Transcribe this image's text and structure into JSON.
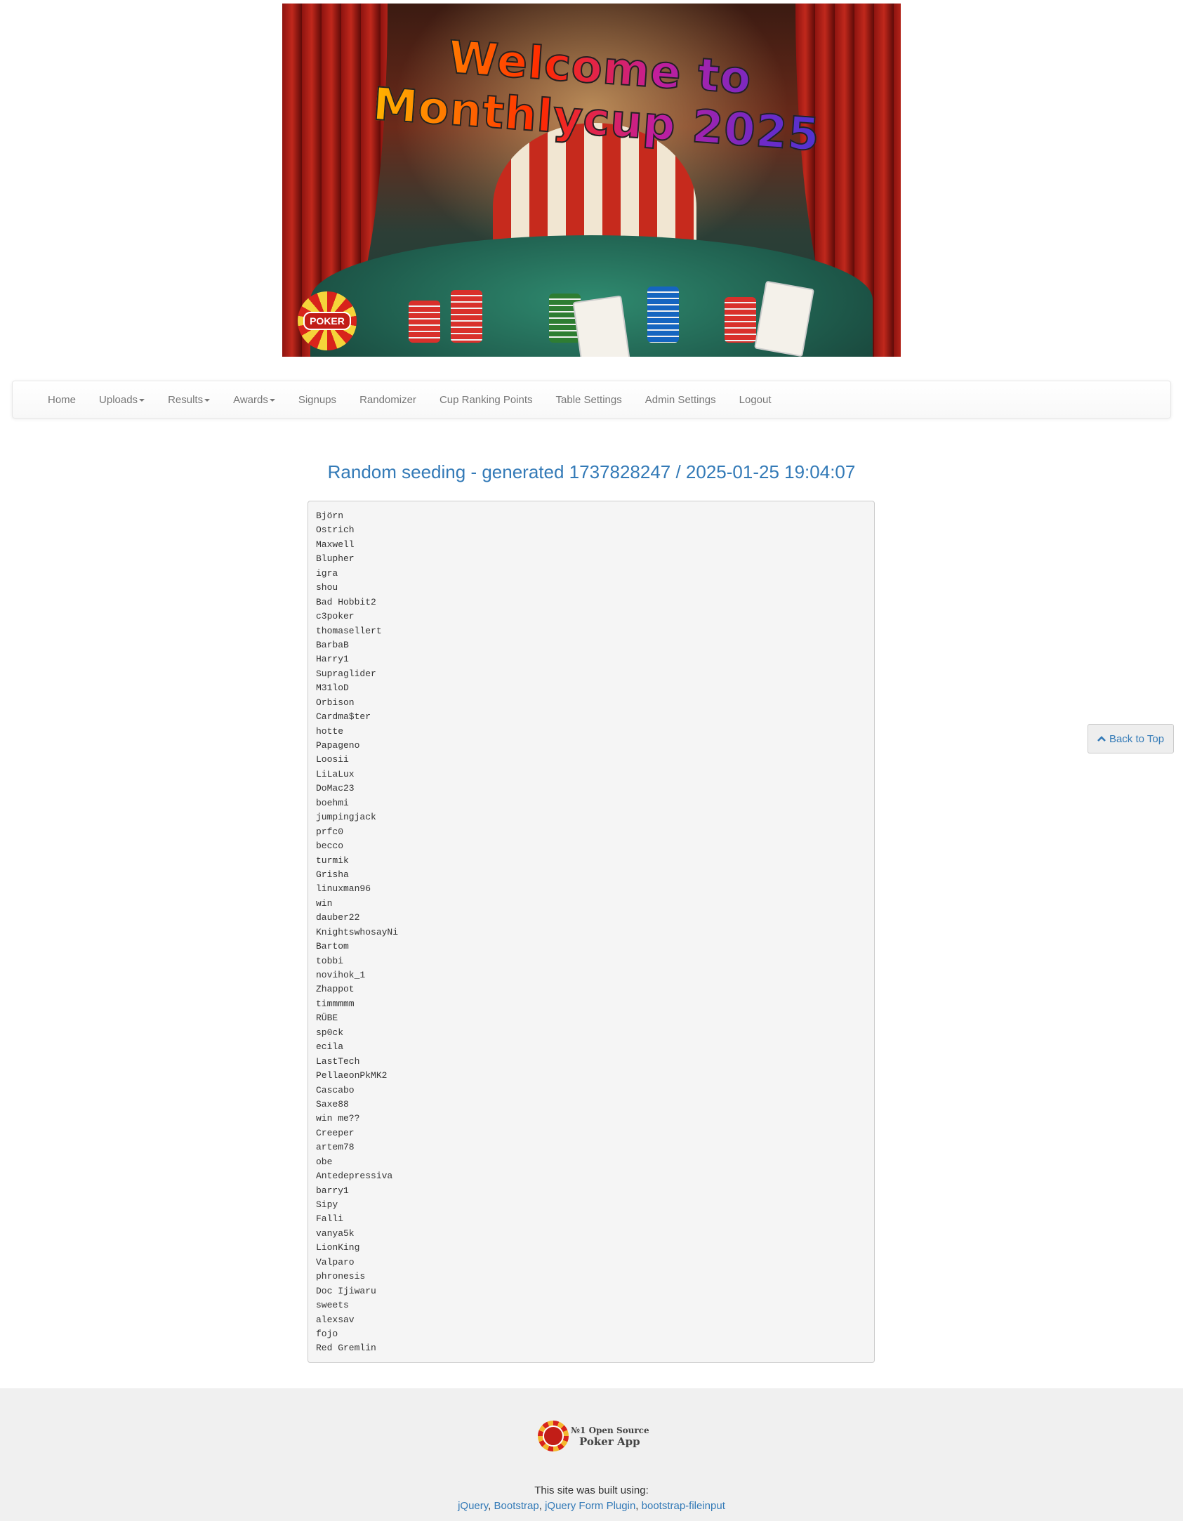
{
  "banner": {
    "title": "Welcome to Monthlycup 2025",
    "logo_text": "POKER"
  },
  "nav": {
    "items": [
      {
        "label": "Home",
        "dropdown": false
      },
      {
        "label": "Uploads",
        "dropdown": true
      },
      {
        "label": "Results",
        "dropdown": true
      },
      {
        "label": "Awards",
        "dropdown": true
      },
      {
        "label": "Signups",
        "dropdown": false
      },
      {
        "label": "Randomizer",
        "dropdown": false
      },
      {
        "label": "Cup Ranking Points",
        "dropdown": false
      },
      {
        "label": "Table Settings",
        "dropdown": false
      },
      {
        "label": "Admin Settings",
        "dropdown": false
      },
      {
        "label": "Logout",
        "dropdown": false
      }
    ]
  },
  "page": {
    "heading": "Random seeding - generated 1737828247 / 2025-01-25 19:04:07"
  },
  "seeding": [
    "Björn",
    "Ostrich",
    "Maxwell",
    "Blupher",
    "igra",
    "shou",
    "Bad Hobbit2",
    "c3poker",
    "thomasellert",
    "BarbaB",
    "Harry1",
    "Supraglider",
    "M31loD",
    "Orbison",
    "Cardma$ter",
    "hotte",
    "Papageno",
    "Loosii",
    "LiLaLux",
    "DoMac23",
    "boehmi",
    "jumpingjack",
    "prfc0",
    "becco",
    "turmik",
    "Grisha",
    "linuxman96",
    "win",
    "dauber22",
    "KnightswhosayNi",
    "Bartom",
    "tobbi",
    "novihok_1",
    "Zhappot",
    "timmmmm",
    "RÜBE",
    "sp0ck",
    "ecila",
    "LastTech",
    "PellaeonPkMK2",
    "Cascabo",
    "Saxe88",
    "win me??",
    "Creeper",
    "artem78",
    "obe",
    "Antedepressiva",
    "barry1",
    "Sipy",
    "Falli",
    "vanya5k",
    "LionKing",
    "Valparo",
    "phronesis",
    "Doc Ijiwaru",
    "sweets",
    "alexsav",
    "fojo",
    "Red Gremlin"
  ],
  "back_to_top": "Back to Top",
  "footer": {
    "logo_line1": "№1 Open Source",
    "logo_line2": "Poker App",
    "built_using": "This site was built using:",
    "links": [
      "jQuery",
      "Bootstrap",
      "jQuery Form Plugin",
      "bootstrap-fileinput"
    ]
  },
  "colors": {
    "link": "#337ab7",
    "nav_text": "#777777",
    "footer_bg": "#f0f0f0",
    "pre_bg": "#f5f5f5"
  }
}
